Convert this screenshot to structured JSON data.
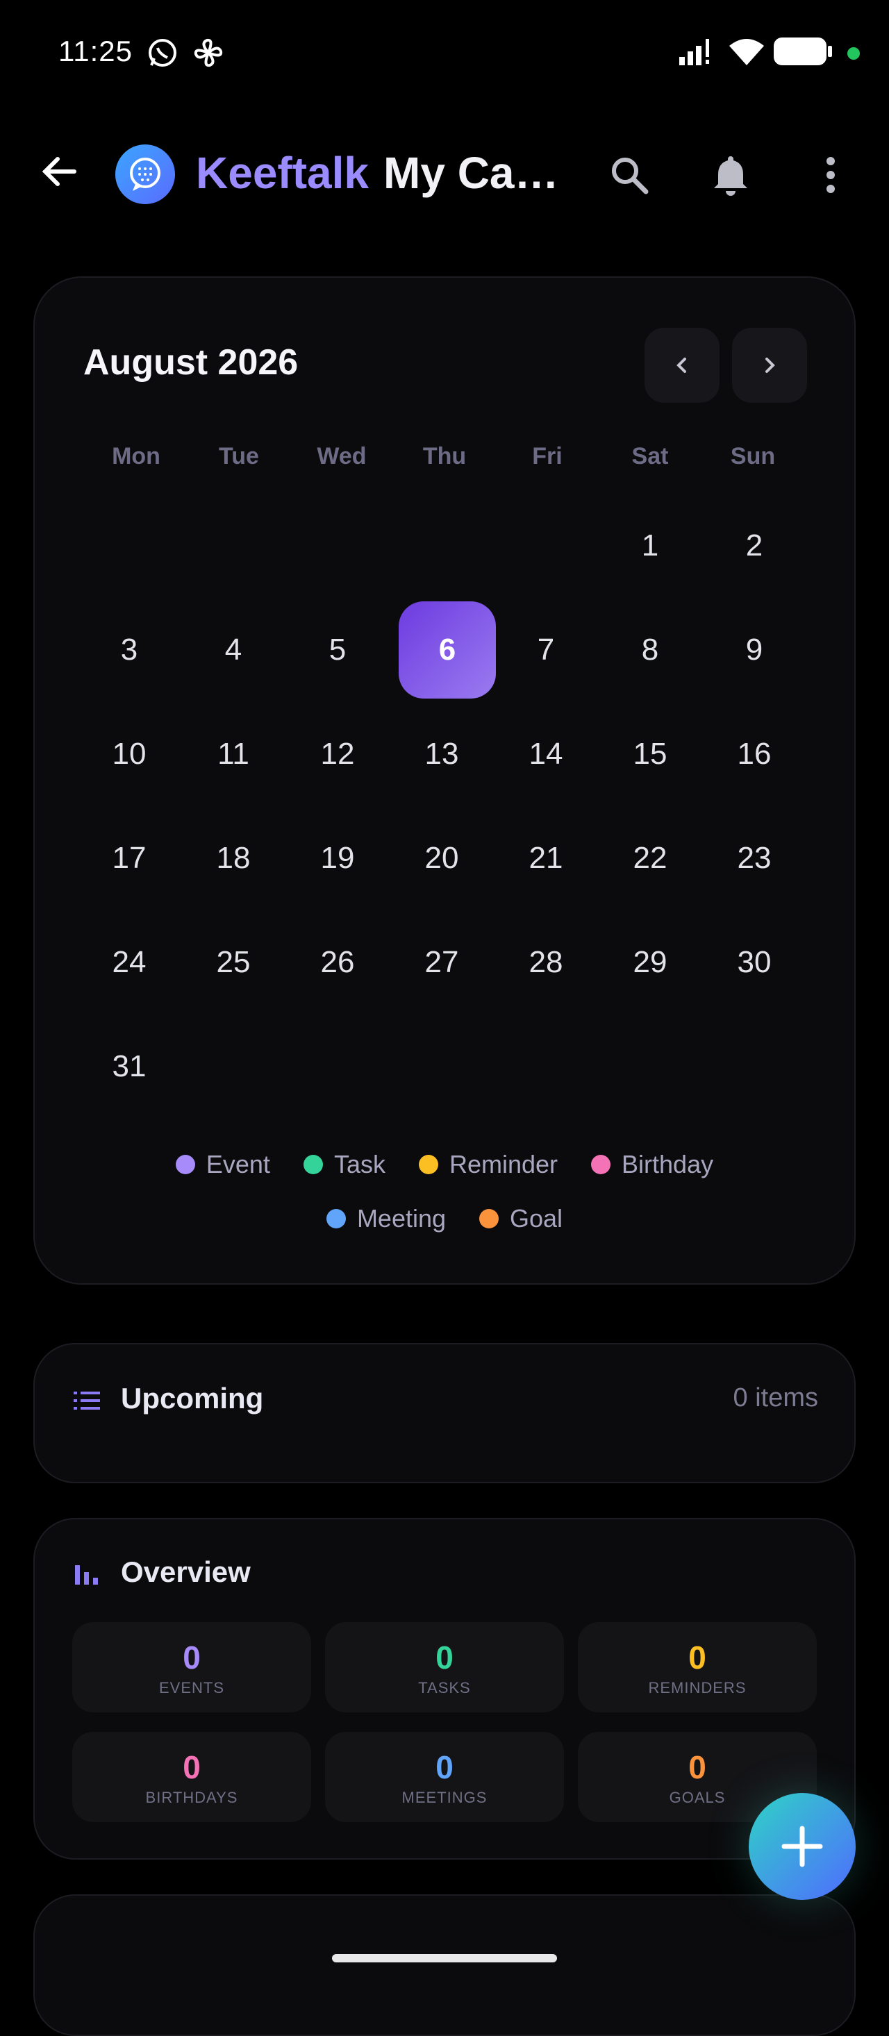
{
  "status_bar": {
    "time": "11:25"
  },
  "app_bar": {
    "brand": "Keeftalk",
    "title": "My Calendar"
  },
  "calendar": {
    "month_label": "August 2026",
    "weekdays": [
      "Mon",
      "Tue",
      "Wed",
      "Thu",
      "Fri",
      "Sat",
      "Sun"
    ],
    "days": [
      "1",
      "2",
      "3",
      "4",
      "5",
      "6",
      "7",
      "8",
      "9",
      "10",
      "11",
      "12",
      "13",
      "14",
      "15",
      "16",
      "17",
      "18",
      "19",
      "20",
      "21",
      "22",
      "23",
      "24",
      "25",
      "26",
      "27",
      "28",
      "29",
      "30",
      "31"
    ],
    "selected_day": "6",
    "legend": [
      {
        "label": "Event",
        "color": "#a78bfa"
      },
      {
        "label": "Task",
        "color": "#34d399"
      },
      {
        "label": "Reminder",
        "color": "#fbbf24"
      },
      {
        "label": "Birthday",
        "color": "#f472b6"
      },
      {
        "label": "Meeting",
        "color": "#60a5fa"
      },
      {
        "label": "Goal",
        "color": "#fb923c"
      }
    ]
  },
  "upcoming": {
    "title": "Upcoming",
    "count": "0 items"
  },
  "overview": {
    "title": "Overview",
    "stats": [
      {
        "value": "0",
        "label": "EVENTS",
        "color": "#a78bfa"
      },
      {
        "value": "0",
        "label": "TASKS",
        "color": "#34d399"
      },
      {
        "value": "0",
        "label": "REMINDERS",
        "color": "#fbbf24"
      },
      {
        "value": "0",
        "label": "BIRTHDAYS",
        "color": "#f472b6"
      },
      {
        "value": "0",
        "label": "MEETINGS",
        "color": "#60a5fa"
      },
      {
        "value": "0",
        "label": "GOALS",
        "color": "#fb923c"
      }
    ]
  }
}
